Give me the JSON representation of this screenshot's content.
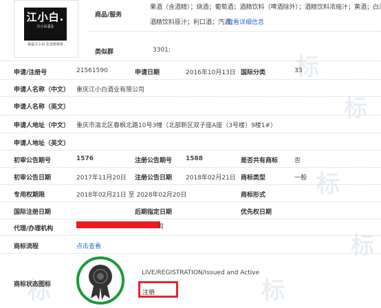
{
  "logo": {
    "brand_text": "江小白.",
    "brand_sub": "江小白酒业",
    "tagline": "我是江小白 生活很简单"
  },
  "goods_services": {
    "label": "商品/服务",
    "line1": "果酒（含酒精）；烧酒；葡萄酒；酒精饮料（啤酒除外）；酒精饮料浓缩汁；黄酒；白酒；",
    "line2": "酒精饮料原汁；利口酒；汽酒；",
    "detail_link": "查看详细信息"
  },
  "similar_group": {
    "label": "类似群",
    "value": "3301;"
  },
  "fields": {
    "reg_no_label": "申请/注册号",
    "reg_no": "21561590",
    "apply_date_label": "申请日期",
    "apply_date": "2016年10月13日",
    "intl_class_label": "国际分类",
    "intl_class": "33",
    "applicant_cn_label": "申请人名称（中文）",
    "applicant_cn": "重庆江小白酒业有限公司",
    "applicant_en_label": "申请人名称（英文）",
    "address_cn_label": "申请人地址（中文）",
    "address_cn": "重庆市渝北区春枫北路10号3幢（北部新区双子座A座（3号楼）9楼1#）",
    "address_en_label": "申请人地址（英文）",
    "prelim_pub_no_label": "初审公告期号",
    "prelim_pub_no": "1576",
    "reg_pub_no_label": "注册公告期号",
    "reg_pub_no": "1588",
    "shared_label": "是否共有商标",
    "shared": "否",
    "prelim_pub_date_label": "初审公告日期",
    "prelim_pub_date": "2017年11月20日",
    "reg_pub_date_label": "注册公告日期",
    "reg_pub_date": "2018年02月21日",
    "mark_type_label": "商标类型",
    "mark_type": "一般",
    "exclusive_period_label": "专用权期限",
    "exclusive_period": "2018年02月21日 至 2028年02月20日",
    "mark_form_label": "商标形式",
    "intl_reg_date_label": "国际注册日期",
    "later_designation_label": "后期指定日期",
    "priority_date_label": "优先权日期",
    "agent_label": "代理/办理机构",
    "agent_tail": "司",
    "process_label": "商标流程",
    "process_link": "点击查看",
    "status_icon_label": "商标状态图标"
  },
  "status": {
    "english": "LIVE/REGISTRATION/Issued and Active",
    "chinese": "注册"
  },
  "watermark": {
    "char": "标"
  },
  "colors": {
    "link": "#2f6fd1",
    "redaction": "#ee1b24",
    "seal_ring": "#1a9a3a",
    "seal_body": "#333333",
    "status_border": "#e8232e"
  }
}
